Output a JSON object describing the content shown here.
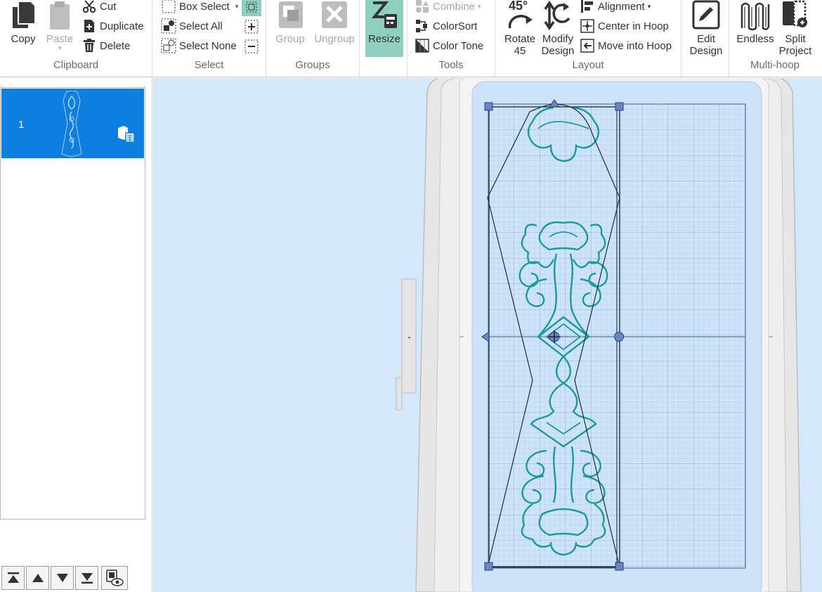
{
  "ribbon": {
    "clipboard": {
      "label": "Clipboard",
      "copy": "Copy",
      "paste": "Paste",
      "cut": "Cut",
      "duplicate": "Duplicate",
      "delete": "Delete"
    },
    "select": {
      "label": "Select",
      "box_select": "Box Select",
      "select_all": "Select All",
      "select_none": "Select None"
    },
    "groups": {
      "label": "Groups",
      "group": "Group",
      "ungroup": "Ungroup"
    },
    "resize": {
      "label": "Resize"
    },
    "tools": {
      "label": "Tools",
      "combine": "Combine",
      "colorsort": "ColorSort",
      "colortone": "Color Tone"
    },
    "layout": {
      "label": "Layout",
      "rotate_line1": "Rotate",
      "rotate_line2": "45",
      "rotate_icon_text": "45°",
      "modify_line1": "Modify",
      "modify_line2": "Design",
      "alignment": "Alignment",
      "center_in_hoop": "Center in Hoop",
      "move_into_hoop": "Move into Hoop"
    },
    "edit": {
      "edit_line1": "Edit",
      "edit_line2": "Design"
    },
    "multihoop": {
      "label": "Multi-hoop",
      "endless": "Endless",
      "split_line1": "Split",
      "split_line2": "Project"
    }
  },
  "design_list": {
    "items": [
      {
        "number": "1"
      }
    ]
  },
  "colors": {
    "accent_selected": "#0d7fe0",
    "resize_active": "#8fcfc0",
    "canvas_bg": "#d3e8fb",
    "stitch": "#1b9a9a",
    "hoop_frame": "#e6e6e6"
  }
}
